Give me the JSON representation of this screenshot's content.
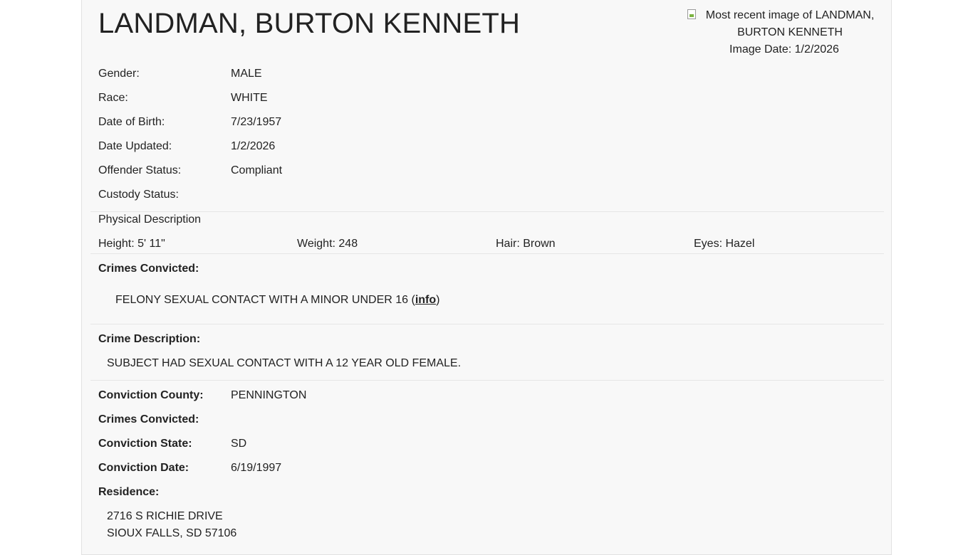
{
  "offender": {
    "name": "LANDMAN, BURTON KENNETH",
    "photo_alt": "Most recent image of LANDMAN, BURTON KENNETH",
    "image_date": "Image Date: 1/2/2026"
  },
  "details": {
    "gender_label": "Gender:",
    "gender": "MALE",
    "race_label": "Race:",
    "race": "WHITE",
    "dob_label": "Date of Birth:",
    "dob": "7/23/1957",
    "updated_label": "Date Updated:",
    "updated": "1/2/2026",
    "status_label": "Offender Status:",
    "status": "Compliant",
    "custody_label": "Custody Status:",
    "custody": ""
  },
  "physical": {
    "heading": "Physical Description",
    "height": "Height: 5' 11\"",
    "weight": "Weight: 248",
    "hair": "Hair: Brown",
    "eyes": "Eyes: Hazel"
  },
  "crimes": {
    "heading": "Crimes Convicted:",
    "item_text": "FELONY SEXUAL CONTACT WITH A MINOR UNDER 16 (",
    "info_link": "info",
    "item_close": ")"
  },
  "crime_description": {
    "heading": "Crime Description:",
    "text": "SUBJECT HAD SEXUAL CONTACT WITH A 12 YEAR OLD FEMALE."
  },
  "conviction": {
    "county_label": "Conviction County:",
    "county": "PENNINGTON",
    "crimes_label": "Crimes Convicted:",
    "crimes": "",
    "state_label": "Conviction State:",
    "state": "SD",
    "date_label": "Conviction Date:",
    "date": "6/19/1997"
  },
  "residence": {
    "label": "Residence:",
    "line1": "2716 S RICHIE DRIVE",
    "line2": "SIOUX FALLS, SD 57106"
  }
}
